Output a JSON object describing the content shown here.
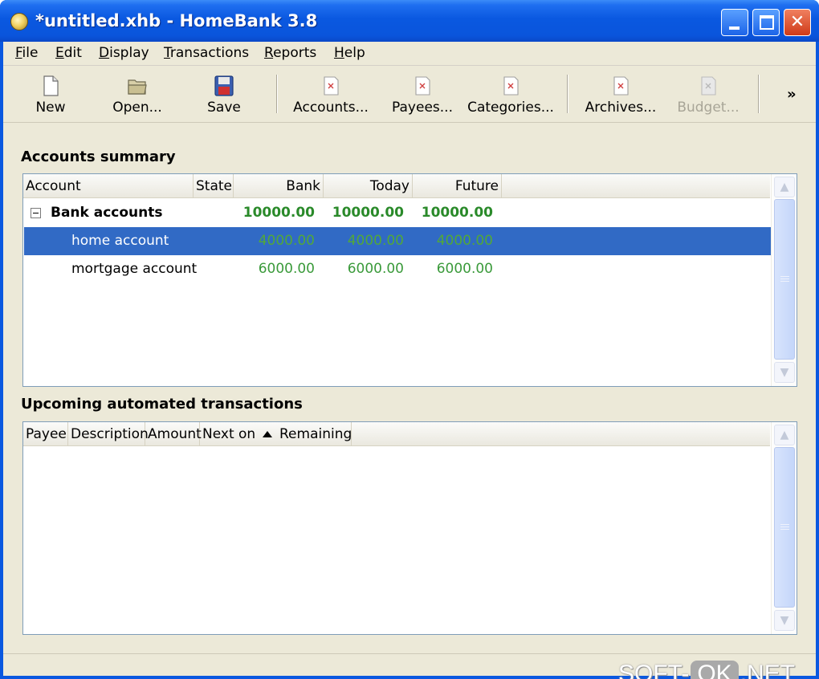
{
  "window": {
    "title": "*untitled.xhb - HomeBank 3.8"
  },
  "menu": [
    {
      "accel": "F",
      "rest": "ile"
    },
    {
      "accel": "E",
      "rest": "dit"
    },
    {
      "accel": "D",
      "rest": "isplay"
    },
    {
      "accel": "T",
      "rest": "ransactions"
    },
    {
      "accel": "R",
      "rest": "eports"
    },
    {
      "accel": "H",
      "rest": "elp"
    }
  ],
  "toolbar": {
    "new": "New",
    "open": "Open...",
    "save": "Save",
    "accounts": "Accounts...",
    "payees": "Payees...",
    "categories": "Categories...",
    "archives": "Archives...",
    "budget": "Budget...",
    "overflow": "»"
  },
  "accounts_summary": {
    "title": "Accounts summary",
    "columns": {
      "account": "Account",
      "state": "State",
      "bank": "Bank",
      "today": "Today",
      "future": "Future"
    },
    "group": {
      "name": "Bank accounts",
      "bank": "10000.00",
      "today": "10000.00",
      "future": "10000.00"
    },
    "rows": [
      {
        "name": "home account",
        "bank": "4000.00",
        "today": "4000.00",
        "future": "4000.00",
        "selected": true
      },
      {
        "name": "mortgage account",
        "bank": "6000.00",
        "today": "6000.00",
        "future": "6000.00",
        "selected": false
      }
    ]
  },
  "upcoming": {
    "title": "Upcoming automated transactions",
    "columns": {
      "payee": "Payee",
      "description": "Description",
      "amount": "Amount",
      "next_on": "Next on",
      "remaining": "Remaining"
    }
  },
  "watermark": {
    "left": "SOFT-",
    "mid": "OK",
    "right": ".NET"
  },
  "colors": {
    "titlebar": "#0a58e0",
    "selection": "#316ac5",
    "amount_green": "#3a9a3a",
    "window_bg": "#ece9d8"
  }
}
